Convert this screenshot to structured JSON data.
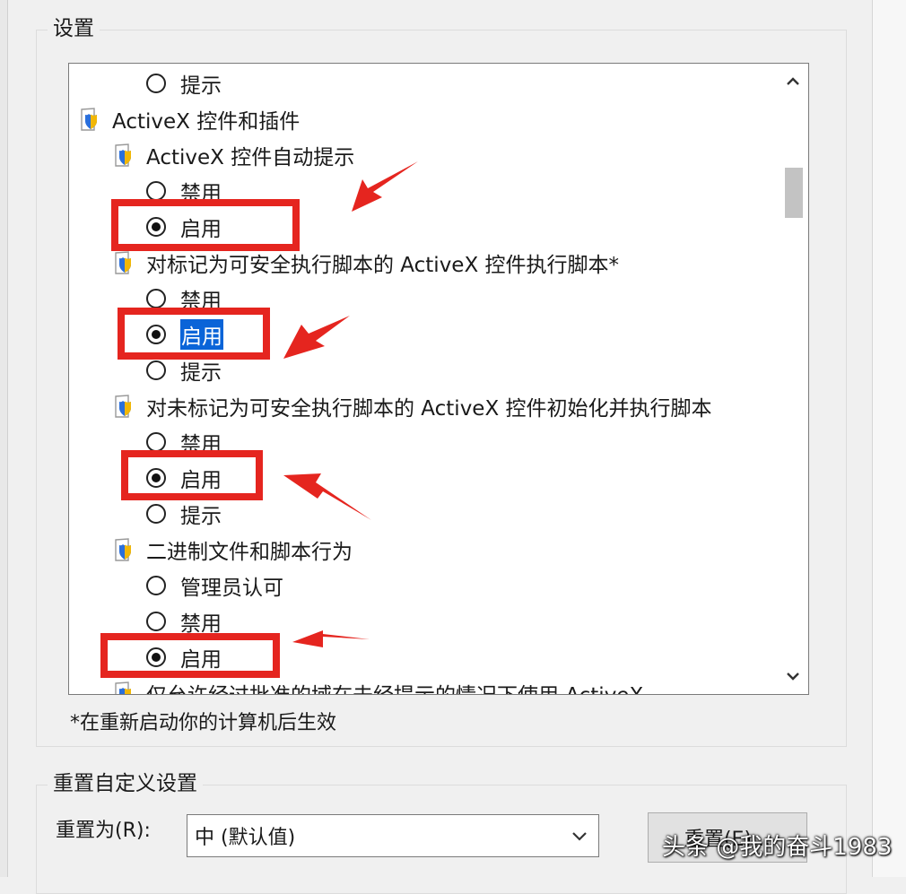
{
  "settings": {
    "title": "设置",
    "items": [
      {
        "type": "radio",
        "label": "提示",
        "checked": false
      },
      {
        "type": "category",
        "label": "ActiveX 控件和插件"
      },
      {
        "type": "setting",
        "label": "ActiveX 控件自动提示"
      },
      {
        "type": "radio",
        "label": "禁用",
        "checked": false
      },
      {
        "type": "radio",
        "label": "启用",
        "checked": true
      },
      {
        "type": "setting",
        "label": "对标记为可安全执行脚本的 ActiveX 控件执行脚本*"
      },
      {
        "type": "radio",
        "label": "禁用",
        "checked": false
      },
      {
        "type": "radio",
        "label": "启用",
        "checked": true,
        "selected": true
      },
      {
        "type": "radio",
        "label": "提示",
        "checked": false
      },
      {
        "type": "setting",
        "label": "对未标记为可安全执行脚本的 ActiveX 控件初始化并执行脚本"
      },
      {
        "type": "radio",
        "label": "禁用",
        "checked": false
      },
      {
        "type": "radio",
        "label": "启用",
        "checked": true
      },
      {
        "type": "radio",
        "label": "提示",
        "checked": false
      },
      {
        "type": "setting",
        "label": "二进制文件和脚本行为"
      },
      {
        "type": "radio",
        "label": "管理员认可",
        "checked": false
      },
      {
        "type": "radio",
        "label": "禁用",
        "checked": false
      },
      {
        "type": "radio",
        "label": "启用",
        "checked": true
      },
      {
        "type": "setting",
        "label": "仅允许经过批准的域在未经提示的情况下使用 ActiveX"
      }
    ],
    "note": "*在重新启动你的计算机后生效"
  },
  "reset": {
    "title": "重置自定义设置",
    "label": "重置为(R):",
    "selected_value": "中 (默认值)",
    "button_label": "重置(E)..."
  },
  "watermark": "头条 @我的奋斗1983",
  "colors": {
    "highlight": "#e5251f",
    "selection": "#0a64d8"
  }
}
